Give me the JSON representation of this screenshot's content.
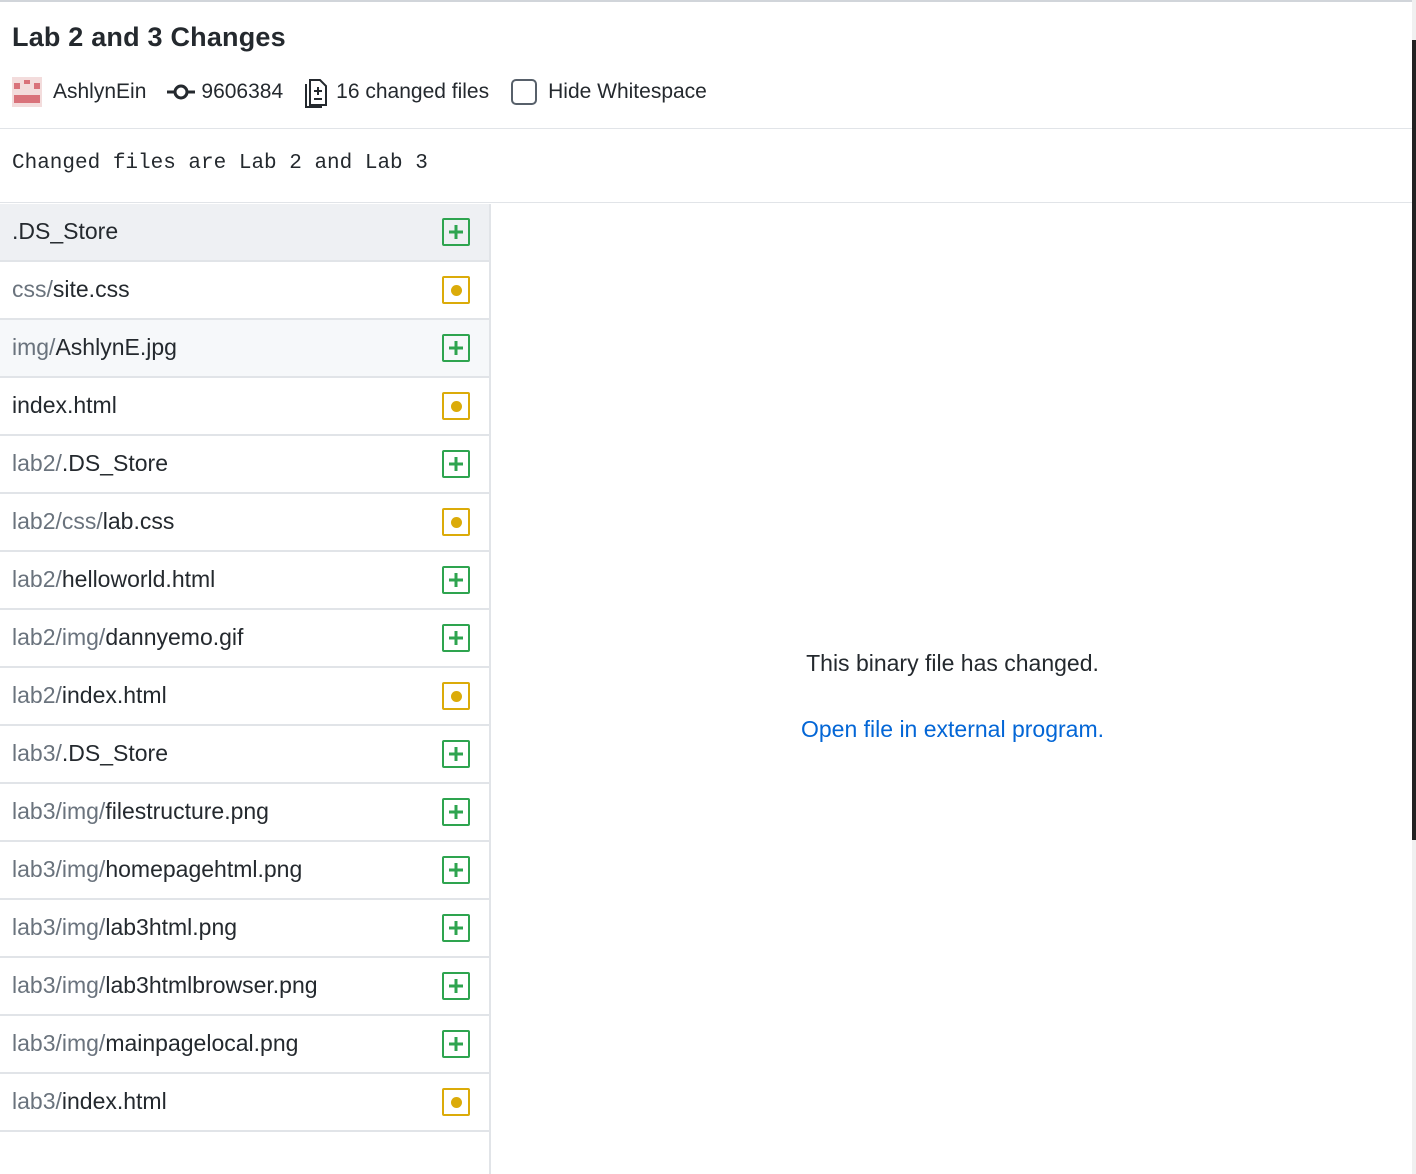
{
  "commit": {
    "title": "Lab 2 and 3 Changes",
    "author": "AshlynEin",
    "sha": "9606384",
    "changed_files_label": "16 changed files",
    "hide_whitespace_label": "Hide Whitespace",
    "hide_whitespace_checked": false,
    "description": "Changed files are Lab 2 and Lab 3"
  },
  "files": [
    {
      "dir": "",
      "name": ".DS_Store",
      "status": "added"
    },
    {
      "dir": "css/",
      "name": "site.css",
      "status": "modified"
    },
    {
      "dir": "img/",
      "name": "AshlynE.jpg",
      "status": "added"
    },
    {
      "dir": "",
      "name": "index.html",
      "status": "modified"
    },
    {
      "dir": "lab2/",
      "name": ".DS_Store",
      "status": "added"
    },
    {
      "dir": "lab2/css/",
      "name": "lab.css",
      "status": "modified"
    },
    {
      "dir": "lab2/",
      "name": "helloworld.html",
      "status": "added"
    },
    {
      "dir": "lab2/img/",
      "name": "dannyemo.gif",
      "status": "added"
    },
    {
      "dir": "lab2/",
      "name": "index.html",
      "status": "modified"
    },
    {
      "dir": "lab3/",
      "name": ".DS_Store",
      "status": "added"
    },
    {
      "dir": "lab3/img/",
      "name": "filestructure.png",
      "status": "added"
    },
    {
      "dir": "lab3/img/",
      "name": "homepagehtml.png",
      "status": "added"
    },
    {
      "dir": "lab3/img/",
      "name": "lab3html.png",
      "status": "added"
    },
    {
      "dir": "lab3/img/",
      "name": "lab3htmlbrowser.png",
      "status": "added"
    },
    {
      "dir": "lab3/img/",
      "name": "mainpagelocal.png",
      "status": "added"
    },
    {
      "dir": "lab3/",
      "name": "index.html",
      "status": "modified"
    }
  ],
  "diff": {
    "binary_message": "This binary file has changed.",
    "open_external_label": "Open file in external program."
  },
  "colors": {
    "added": "#2ea44f",
    "modified": "#dbab09",
    "link": "#0366d6",
    "selected_row": "#eef0f3"
  },
  "icons": {
    "author": "avatar-icon",
    "sha": "git-commit-icon",
    "files": "diff-file-icon",
    "added": "plus-square-icon",
    "modified": "dot-square-icon"
  }
}
